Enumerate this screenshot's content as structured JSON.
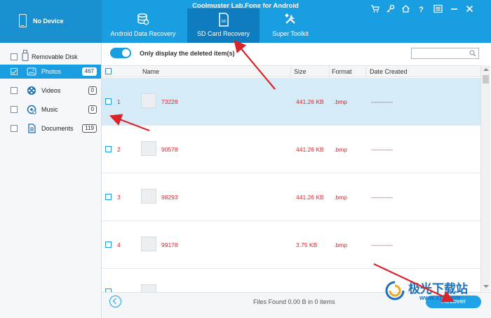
{
  "app": {
    "title": "Coolmuster Lab.Fone for Android",
    "device_label": "No Device"
  },
  "tabs": [
    {
      "label": "Android Data Recovery",
      "icon": "database-icon",
      "active": false
    },
    {
      "label": "SD Card Recovery",
      "icon": "sd-card-icon",
      "active": true
    },
    {
      "label": "Super Toolkit",
      "icon": "tools-icon",
      "active": false
    }
  ],
  "window_controls": [
    "cart-icon",
    "key-icon",
    "home-icon",
    "help-icon",
    "menu-icon",
    "minimize-icon",
    "close-icon"
  ],
  "sidebar": {
    "root_label": "Removable Disk",
    "items": [
      {
        "label": "Photos",
        "count": "467",
        "icon": "photo-icon",
        "active": true,
        "checked": true
      },
      {
        "label": "Videos",
        "count": "0",
        "icon": "film-icon",
        "active": false,
        "checked": false
      },
      {
        "label": "Music",
        "count": "0",
        "icon": "music-icon",
        "active": false,
        "checked": false
      },
      {
        "label": "Documents",
        "count": "119",
        "icon": "document-icon",
        "active": false,
        "checked": false
      }
    ]
  },
  "toolbar": {
    "toggle_label": "Only display the deleted item(s)",
    "toggle_on": true
  },
  "table": {
    "columns": [
      "Name",
      "Size",
      "Format",
      "Date Created"
    ],
    "rows": [
      {
        "index": "1",
        "name": "73228",
        "size": "441.26 KB",
        "format": ".bmp",
        "date": "-----------",
        "selected": true
      },
      {
        "index": "2",
        "name": "90578",
        "size": "441.26 KB",
        "format": ".bmp",
        "date": "-----------",
        "selected": false
      },
      {
        "index": "3",
        "name": "98293",
        "size": "441.26 KB",
        "format": ".bmp",
        "date": "-----------",
        "selected": false
      },
      {
        "index": "4",
        "name": "99178",
        "size": "3.75 KB",
        "format": ".bmp",
        "date": "-----------",
        "selected": false
      }
    ]
  },
  "footer": {
    "status": "Files Found 0.00 B in 0 items",
    "recover_label": "Recover"
  },
  "watermark": {
    "text": "极光下载站",
    "url": "www.xz7.com"
  },
  "colors": {
    "header": "#1a9ee2",
    "accent": "#1a9ee2",
    "file_text": "#e0242b",
    "selected_row": "#d5ebf7",
    "annotation_arrow": "#d9252a"
  }
}
